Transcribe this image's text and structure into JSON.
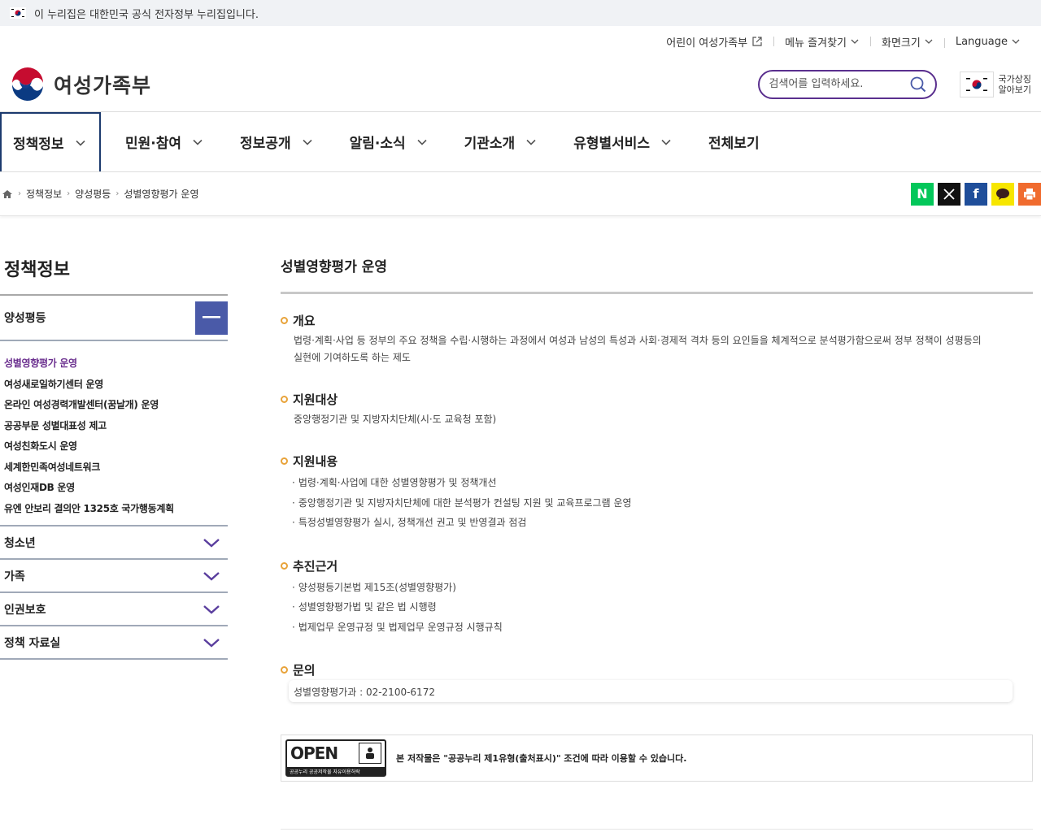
{
  "gov_banner": {
    "text": "이 누리집은 대한민국 공식 전자정부 누리집입니다."
  },
  "utility": {
    "kids_site": "어린이 여성가족부",
    "bookmark": "메뉴 즐겨찾기",
    "font_size": "화면크기",
    "language": "Language"
  },
  "header": {
    "logo_text": "여성가족부",
    "search_placeholder": "검색어를 입력하세요.",
    "emblem_line1": "국가상징",
    "emblem_line2": "알아보기"
  },
  "gnb": {
    "items": [
      {
        "label": "정책정보"
      },
      {
        "label": "민원·참여"
      },
      {
        "label": "정보공개"
      },
      {
        "label": "알림·소식"
      },
      {
        "label": "기관소개"
      },
      {
        "label": "유형별서비스"
      },
      {
        "label": "전체보기"
      }
    ]
  },
  "breadcrumb": {
    "level1": "정책정보",
    "level2": "양성평등",
    "level3": "성별영향평가 운영"
  },
  "share_icons": [
    "naver-blog-icon",
    "x-twitter-icon",
    "facebook-icon",
    "kakaotalk-icon",
    "print-icon"
  ],
  "colors": {
    "accent_purple": "#6a2e8e",
    "nav_blue": "#1c3a6e",
    "toggle_blue": "#4a5aa8",
    "bullet_orange": "#e8a33a"
  },
  "lnb": {
    "title": "정책정보",
    "open_group": "양성평등",
    "sub_items": [
      "성별영향평가 운영",
      "여성새로일하기센터 운영",
      "온라인 여성경력개발센터(꿈날개) 운영",
      "공공부문 성별대표성 제고",
      "여성친화도시 운영",
      "세계한민족여성네트워크",
      "여성인재DB 운영",
      "유엔 안보리 결의안 1325호 국가행동계획"
    ],
    "groups": [
      "청소년",
      "가족",
      "인권보호",
      "정책 자료실"
    ]
  },
  "main": {
    "title": "성별영향평가 운영",
    "overview": {
      "heading": "개요",
      "line1": "법령·계획·사업 등 정부의 주요 정책을 수립·시행하는 과정에서 여성과 남성의 특성과 사회·경제적 격차 등의 요인들을 체계적으로 분석평가함으로써 정부 정책이 성평등의",
      "line2": "실현에 기여하도록 하는 제도"
    },
    "targets": {
      "heading": "지원대상",
      "text": "중앙행정기관 및 지방자치단체(시·도 교육청 포함)"
    },
    "contents": {
      "heading": "지원내용",
      "items": [
        "법령·계획·사업에 대한 성별영향평가 및 정책개선",
        "중앙행정기관 및 지방자치단체에 대한 분석평가 컨설팅 지원 및 교육프로그램 운영",
        "특정성별영향평가 실시, 정책개선 권고 및 반영결과 점검"
      ]
    },
    "basis": {
      "heading": "추진근거",
      "items": [
        "양성평등기본법 제15조(성별영향평가)",
        "성별영향평가법 및 같은 법 시행령",
        "법제업무 운영규정 및 법제업무 운영규정 시행규칙"
      ]
    },
    "inquiry": {
      "heading": "문의",
      "text": "성별영향평가과 : 02-2100-6172"
    },
    "license": {
      "badge_word": "OPEN",
      "badge_caption": "공공누리 공공저작물 자유이용허락",
      "text": "본 저작물은 \"공공누리 제1유형(출처표시)\" 조건에 따라 이용할 수 있습니다."
    }
  }
}
